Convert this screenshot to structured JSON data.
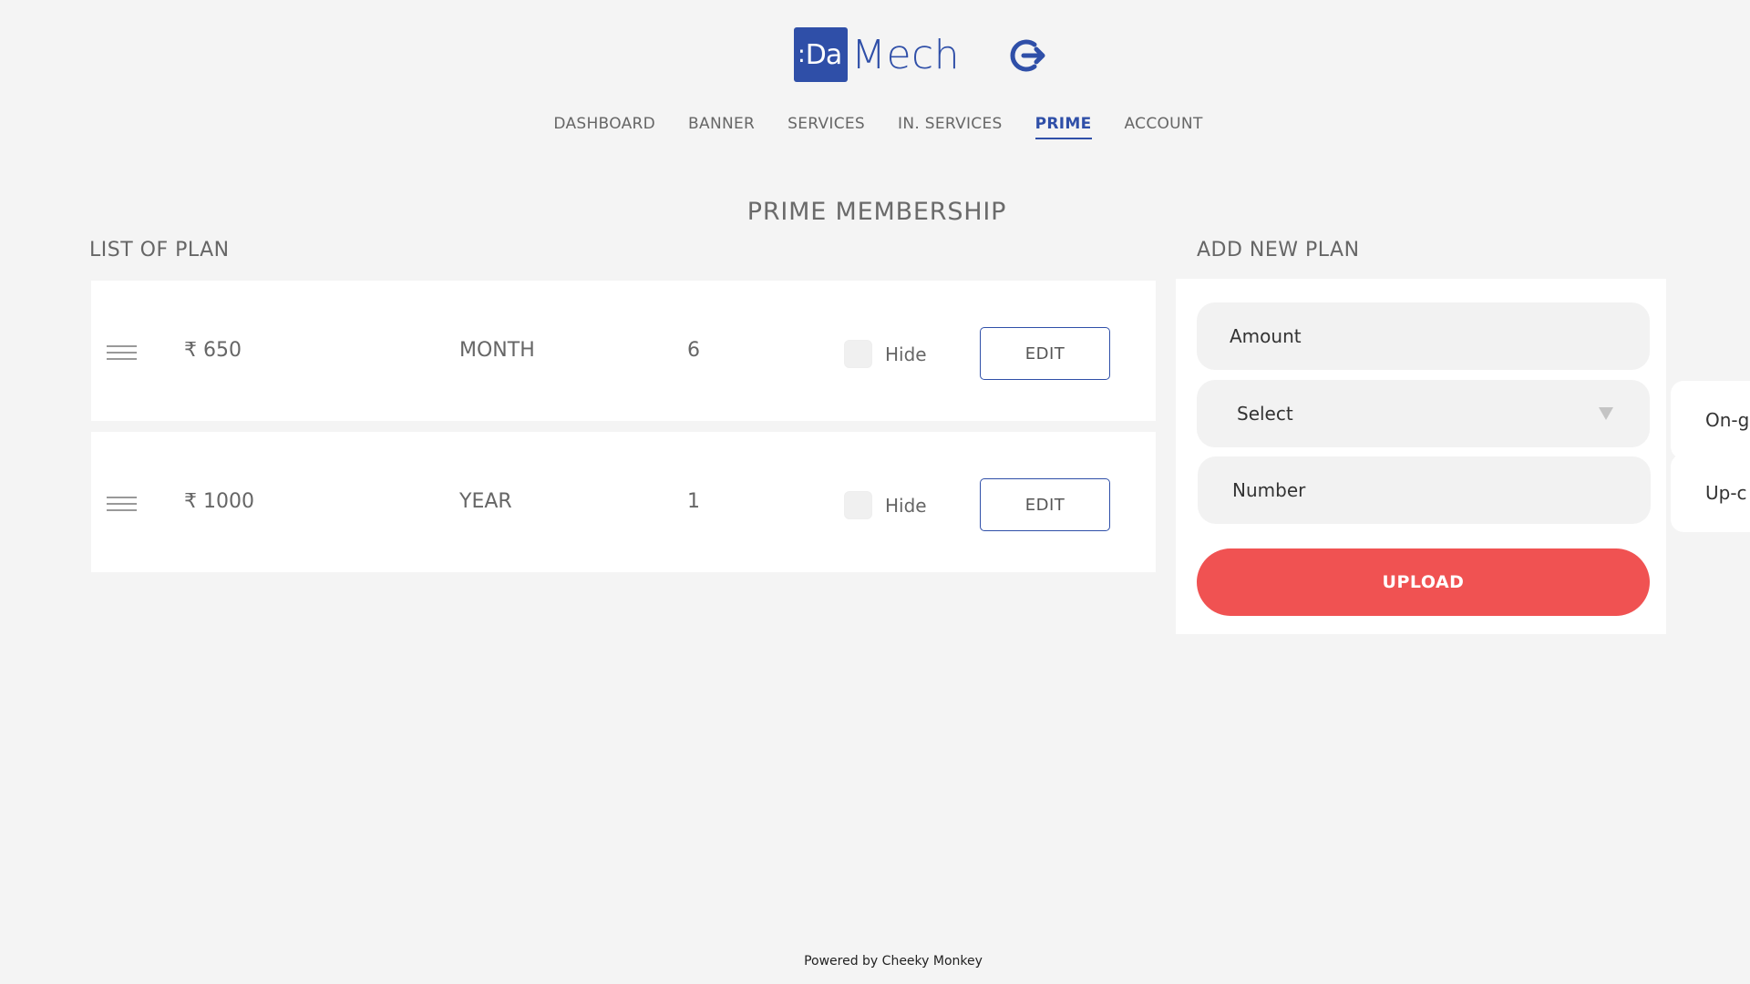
{
  "brand": {
    "logo_mark": "Da",
    "logo_text": "Mech",
    "accent_color": "#2f4fa8"
  },
  "header": {
    "logout_icon": "logout-icon"
  },
  "nav": {
    "items": [
      {
        "label": "DASHBOARD",
        "active": false
      },
      {
        "label": "BANNER",
        "active": false
      },
      {
        "label": "SERVICES",
        "active": false
      },
      {
        "label": "IN. SERVICES",
        "active": false
      },
      {
        "label": "PRIME",
        "active": true
      },
      {
        "label": "ACCOUNT",
        "active": false
      }
    ]
  },
  "page": {
    "title": "PRIME MEMBERSHIP"
  },
  "plans": {
    "title": "LIST OF PLAN",
    "rows": [
      {
        "amount": "₹ 650",
        "period": "MONTH",
        "count": "6",
        "hide_label": "Hide",
        "hidden": false,
        "edit_label": "EDIT"
      },
      {
        "amount": "₹ 1000",
        "period": "YEAR",
        "count": "1",
        "hide_label": "Hide",
        "hidden": false,
        "edit_label": "EDIT"
      }
    ]
  },
  "add_plan": {
    "title": "ADD NEW PLAN",
    "amount_placeholder": "Amount",
    "select_value": "Select",
    "number_placeholder": "Number",
    "upload_label": "UPLOAD",
    "upload_color": "#f05252"
  },
  "side_cards": [
    {
      "label": "On-g"
    },
    {
      "label": "Up-c"
    }
  ],
  "footer": {
    "text": "Powered by Cheeky Monkey"
  }
}
